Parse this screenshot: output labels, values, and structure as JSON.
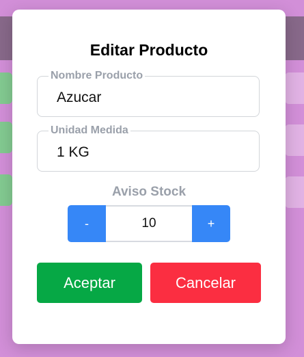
{
  "modal": {
    "title": "Editar Producto",
    "fields": [
      {
        "legend": "Nombre Producto",
        "value": "Azucar"
      },
      {
        "legend": "Unidad Medida",
        "value": "1 KG"
      }
    ],
    "stock": {
      "label": "Aviso Stock",
      "minus_label": "-",
      "plus_label": "+",
      "value": "10"
    },
    "buttons": {
      "accept_label": "Aceptar",
      "cancel_label": "Cancelar"
    }
  },
  "colors": {
    "overlay": "#d28fd8",
    "accent_blue": "#3687f7",
    "accept_green": "#06a845",
    "cancel_red": "#fb2e41",
    "legend_gray": "#9aa0aa"
  }
}
